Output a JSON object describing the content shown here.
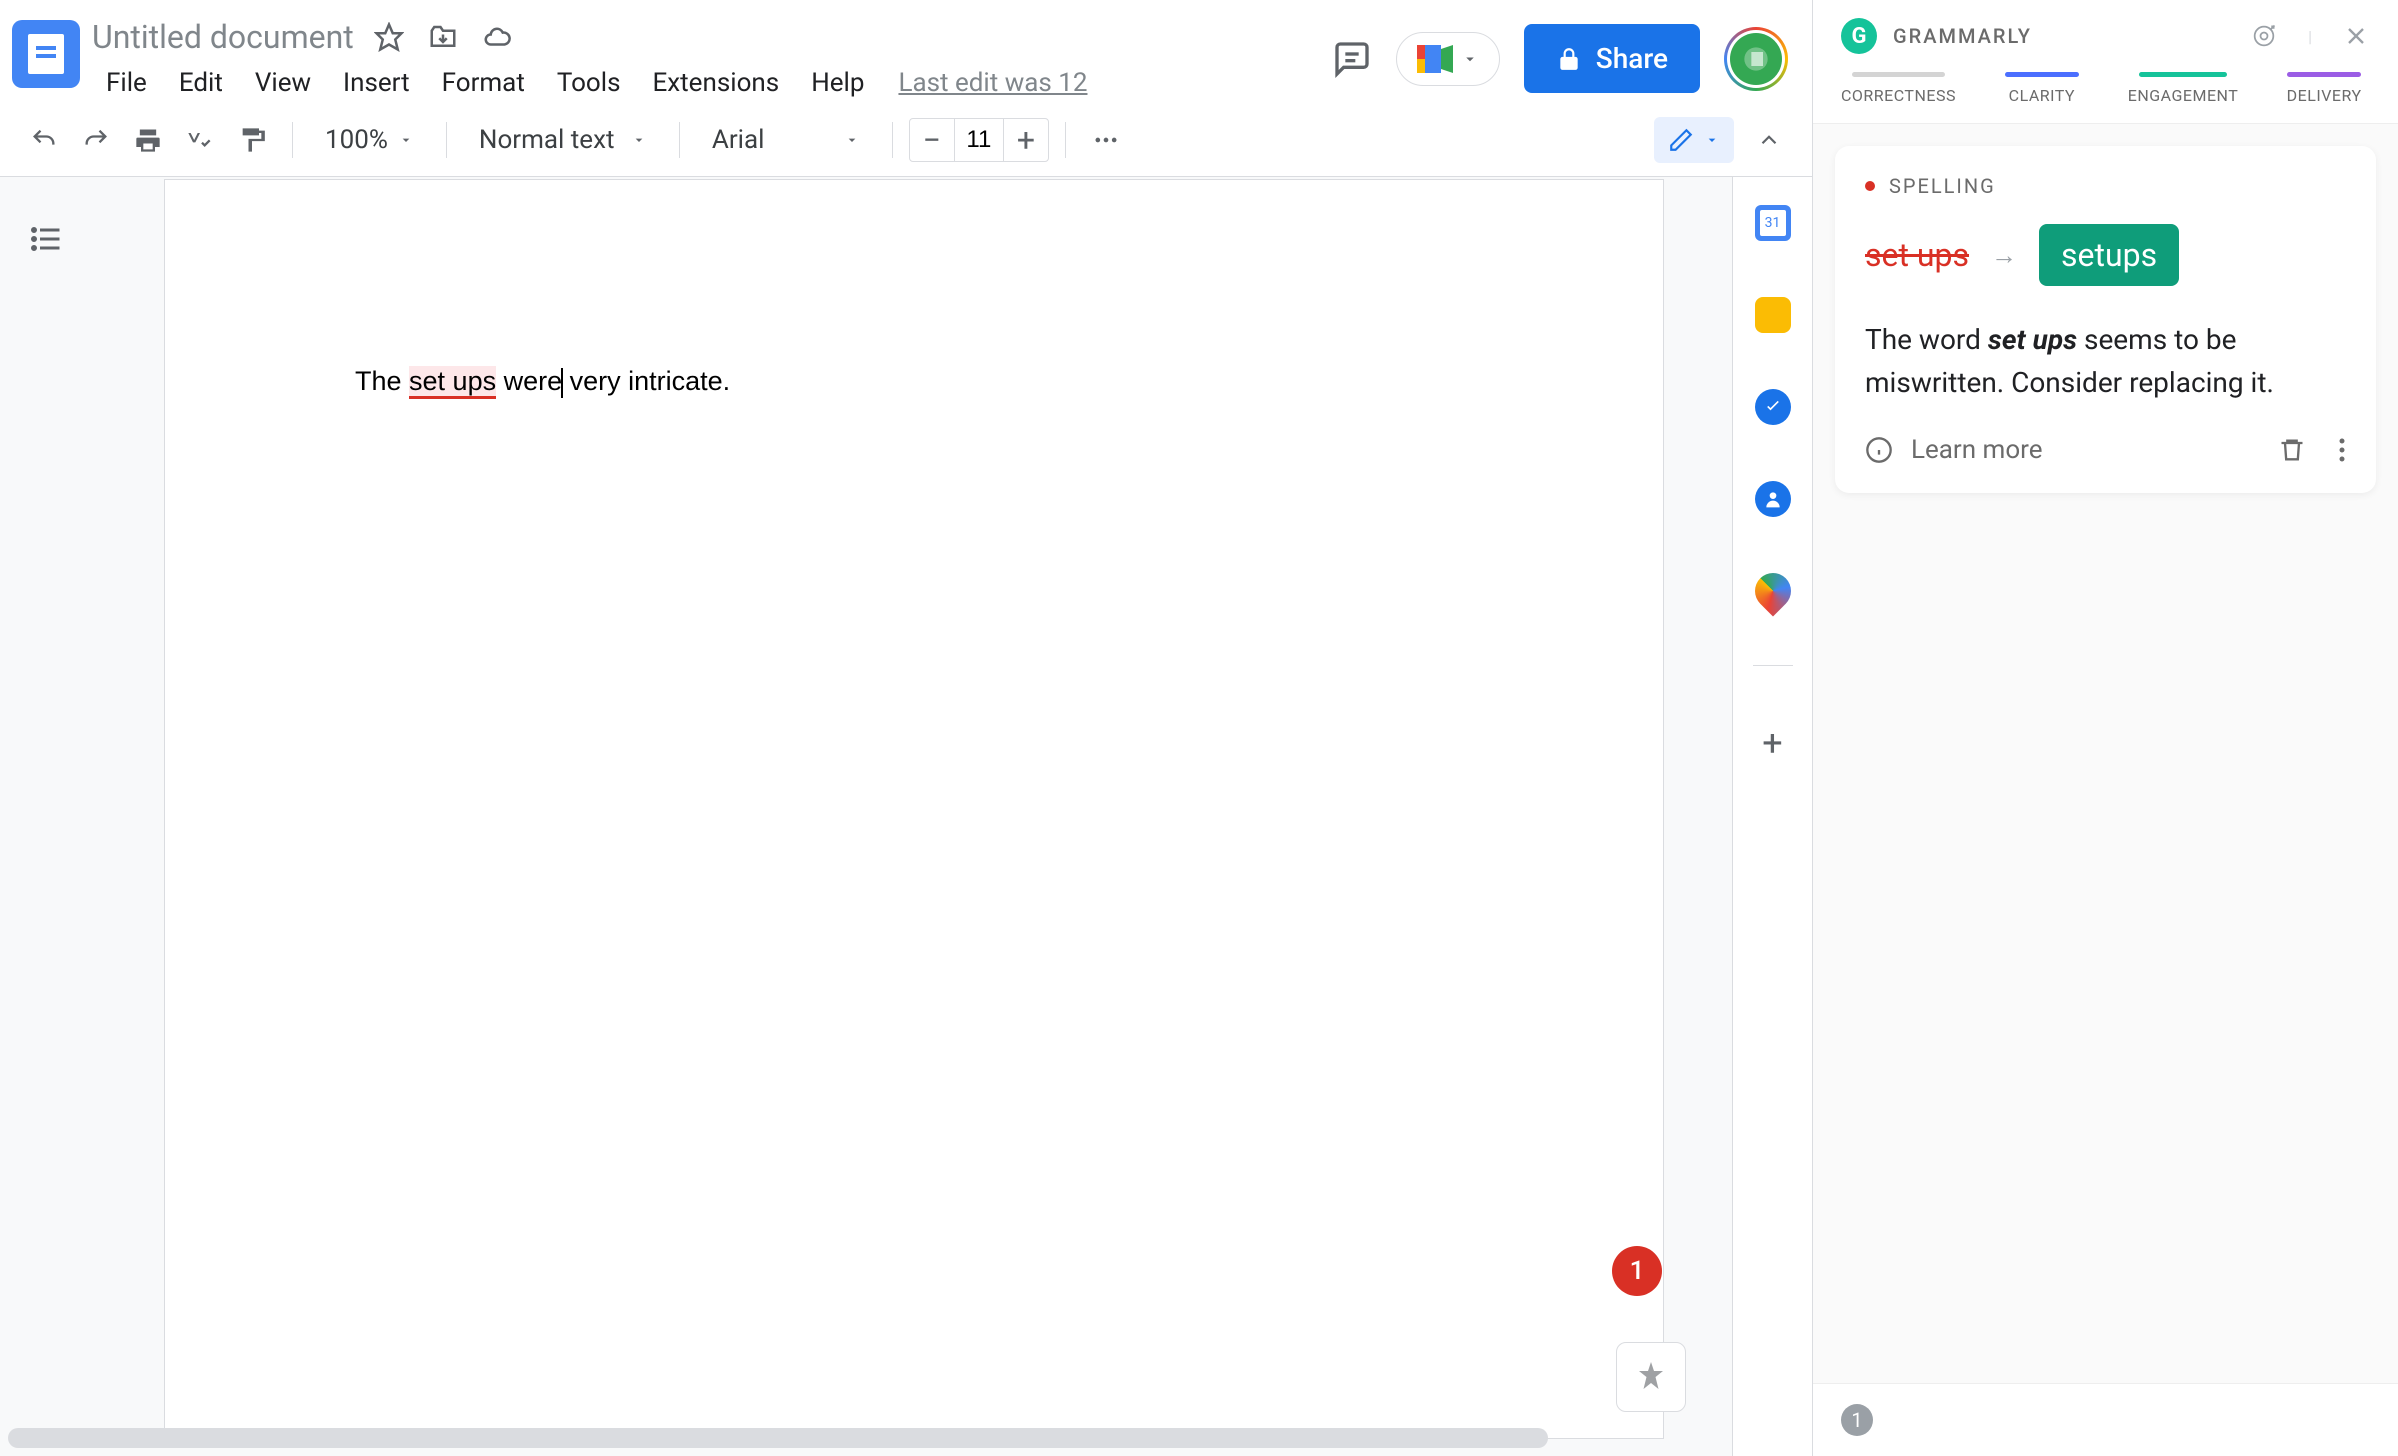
{
  "docTitle": "Untitled document",
  "menus": [
    "File",
    "Edit",
    "View",
    "Insert",
    "Format",
    "Tools",
    "Extensions",
    "Help"
  ],
  "lastEdit": "Last edit was 12",
  "shareLabel": "Share",
  "toolbar": {
    "zoom": "100%",
    "style": "Normal text",
    "font": "Arial",
    "fontSize": "11"
  },
  "document": {
    "before": "The ",
    "error": "set ups",
    "mid": " were",
    "after": " very intricate."
  },
  "apps": {
    "calendarDay": "31"
  },
  "grammarly": {
    "brand": "GRAMMARLY",
    "tabs": {
      "correctness": "CORRECTNESS",
      "clarity": "CLARITY",
      "engagement": "ENGAGEMENT",
      "delivery": "DELIVERY"
    },
    "card": {
      "category": "SPELLING",
      "old": "set ups",
      "new": "setups",
      "descPrefix": "The word ",
      "descBold": "set ups",
      "descSuffix": " seems to be miswritten. Consider replacing it.",
      "learnMore": "Learn more"
    },
    "count": "1"
  },
  "badgeCount": "1"
}
